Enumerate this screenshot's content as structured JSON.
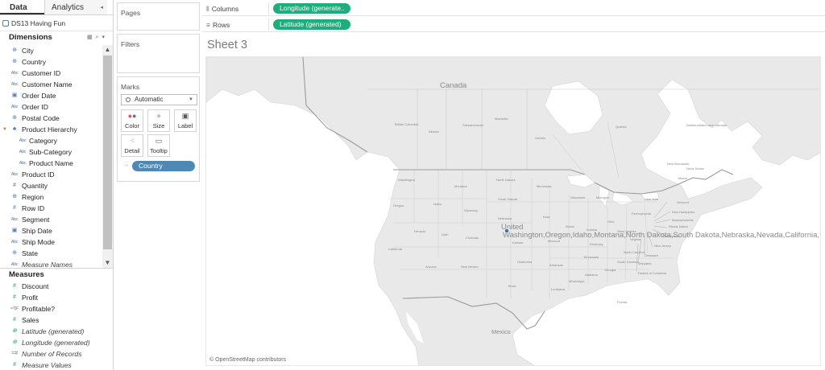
{
  "data_pane": {
    "tabs": {
      "data": "Data",
      "analytics": "Analytics"
    },
    "datasource": "DS13 Having Fun",
    "dimensions_title": "Dimensions",
    "dimensions": [
      {
        "label": "City",
        "icon": "globe-icon"
      },
      {
        "label": "Country",
        "icon": "globe-icon"
      },
      {
        "label": "Customer ID",
        "icon": "abc-icon"
      },
      {
        "label": "Customer Name",
        "icon": "abc-icon"
      },
      {
        "label": "Order Date",
        "icon": "calendar-icon"
      },
      {
        "label": "Order ID",
        "icon": "abc-icon"
      },
      {
        "label": "Postal Code",
        "icon": "globe-icon"
      },
      {
        "label": "Product Hierarchy",
        "icon": "hierarchy-icon"
      },
      {
        "label": "Category",
        "icon": "abc-icon"
      },
      {
        "label": "Sub-Category",
        "icon": "abc-icon"
      },
      {
        "label": "Product Name",
        "icon": "abc-icon"
      },
      {
        "label": "Product ID",
        "icon": "abc-icon"
      },
      {
        "label": "Quantity",
        "icon": "number-icon"
      },
      {
        "label": "Region",
        "icon": "globe-icon"
      },
      {
        "label": "Row ID",
        "icon": "number-icon"
      },
      {
        "label": "Segment",
        "icon": "abc-icon"
      },
      {
        "label": "Ship Date",
        "icon": "calendar-icon"
      },
      {
        "label": "Ship Mode",
        "icon": "abc-icon"
      },
      {
        "label": "State",
        "icon": "globe-icon"
      },
      {
        "label": "Measure Names",
        "icon": "abc-icon"
      }
    ],
    "measures_title": "Measures",
    "measures": [
      {
        "label": "Discount",
        "icon": "number-icon"
      },
      {
        "label": "Profit",
        "icon": "number-icon"
      },
      {
        "label": "Profitable?",
        "icon": "boolean-icon"
      },
      {
        "label": "Sales",
        "icon": "number-icon"
      },
      {
        "label": "Latitude (generated)",
        "icon": "globe-icon"
      },
      {
        "label": "Longitude (generated)",
        "icon": "globe-icon"
      },
      {
        "label": "Number of Records",
        "icon": "number-icon"
      },
      {
        "label": "Measure Values",
        "icon": "number-icon"
      }
    ]
  },
  "cards": {
    "pages": "Pages",
    "filters": "Filters",
    "marks": "Marks",
    "mark_type": "Automatic",
    "buttons": {
      "color": "Color",
      "size": "Size",
      "label": "Label",
      "detail": "Detail",
      "tooltip": "Tooltip"
    },
    "detail_pill": "Country"
  },
  "shelves": {
    "columns_label": "Columns",
    "columns_pill": "Longitude (generate..",
    "rows_label": "Rows",
    "rows_pill": "Latitude (generated)"
  },
  "sheet": {
    "title": "Sheet 3",
    "attribution": "© OpenStreetMap contributors"
  },
  "map_labels": {
    "canada": "Canada",
    "united": "United",
    "states": [
      "Washington",
      "Oregon",
      "Idaho",
      "Montana",
      "North Dakota",
      "South Dakota",
      "Nebraska",
      "Nevada",
      "California",
      "Utah",
      "Colorado",
      "Kansas",
      "Arizona",
      "New Mexico",
      "Oklahoma",
      "Texas",
      "Missouri",
      "Iowa",
      "Illinois",
      "Kentucky",
      "Tennessee",
      "Arkansas",
      "Alabama",
      "Georgia",
      "Florida",
      "North Carolina",
      "Virginia",
      "Pennsylvania",
      "Ohio",
      "Indiana",
      "Michigan",
      "Wisconsin",
      "Minnesota",
      "New York",
      "Maine",
      "Louisiana",
      "Mississippi",
      "South Carolina",
      "West Virginia",
      "Wyoming"
    ],
    "mexico": "Mexico",
    "provinces": [
      "British Columbia",
      "Alberta",
      "Saskatchewan",
      "Manitoba",
      "Ontario",
      "Quebec",
      "Newfoundland and Labrador",
      "New Brunswick",
      "Nova Scotia"
    ],
    "callouts": [
      "Vermont",
      "New Hampshire",
      "Massachusetts",
      "Rhode Island",
      "Connecticut",
      "New Jersey",
      "Delaware",
      "Maryland",
      "District of Columbia"
    ]
  },
  "colors": {
    "pill_green": "#1ead7c",
    "pill_blue": "#4e89b5",
    "land": "#e9e9e9",
    "mark": "#3e72a6"
  }
}
